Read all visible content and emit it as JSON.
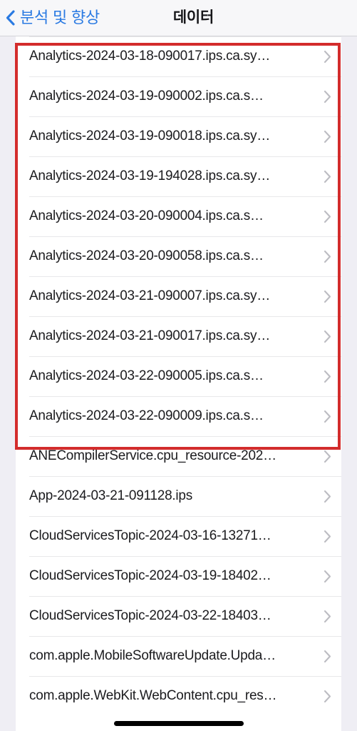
{
  "navbar": {
    "back_label": "분석 및 향상",
    "back_icon": "chevron-left-icon",
    "title": "데이터",
    "accent_color": "#2a7ae2"
  },
  "list": {
    "disclosure_icon": "chevron-right-icon",
    "rows": [
      {
        "label": "Analytics-2024-03-18-090017.ips.ca.sy…"
      },
      {
        "label": "Analytics-2024-03-19-090002.ips.ca.s…"
      },
      {
        "label": "Analytics-2024-03-19-090018.ips.ca.sy…"
      },
      {
        "label": "Analytics-2024-03-19-194028.ips.ca.sy…"
      },
      {
        "label": "Analytics-2024-03-20-090004.ips.ca.s…"
      },
      {
        "label": "Analytics-2024-03-20-090058.ips.ca.s…"
      },
      {
        "label": "Analytics-2024-03-21-090007.ips.ca.sy…"
      },
      {
        "label": "Analytics-2024-03-21-090017.ips.ca.sy…"
      },
      {
        "label": "Analytics-2024-03-22-090005.ips.ca.s…"
      },
      {
        "label": "Analytics-2024-03-22-090009.ips.ca.s…"
      },
      {
        "label": "ANECompilerService.cpu_resource-202…"
      },
      {
        "label": "App-2024-03-21-091128.ips"
      },
      {
        "label": "CloudServicesTopic-2024-03-16-13271…"
      },
      {
        "label": "CloudServicesTopic-2024-03-19-18402…"
      },
      {
        "label": "CloudServicesTopic-2024-03-22-18403…"
      },
      {
        "label": "com.apple.MobileSoftwareUpdate.Upda…"
      },
      {
        "label": "com.apple.WebKit.WebContent.cpu_res…"
      }
    ]
  },
  "annotation": {
    "color": "#d32c2c",
    "highlighted_row_count": 10
  }
}
